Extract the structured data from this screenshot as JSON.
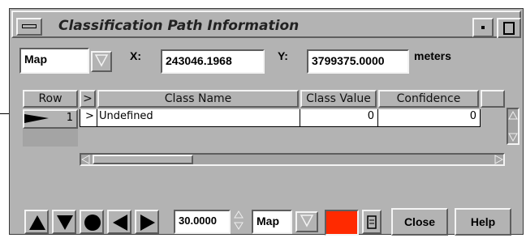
{
  "window": {
    "title": "Classification Path Information"
  },
  "top_bar": {
    "view_select": "Map",
    "x_label": "X:",
    "x_value": "243046.1968",
    "y_label": "Y:",
    "y_value": "3799375.0000",
    "units": "meters"
  },
  "table": {
    "columns": [
      "Row",
      ">",
      "Class Name",
      "Class Value",
      "Confidence"
    ],
    "rows": [
      {
        "row": "1",
        "marker": ">",
        "class_name": "Undefined",
        "class_value": "0",
        "confidence": "0"
      }
    ]
  },
  "bottom_bar": {
    "zoom_value": "30.0000",
    "view_select": "Map",
    "color_swatch": "#ff2a00",
    "close_label": "Close",
    "help_label": "Help"
  },
  "icons": [
    "up-arrow-icon",
    "down-arrow-icon",
    "dot-icon",
    "left-arrow-icon",
    "right-arrow-icon"
  ]
}
